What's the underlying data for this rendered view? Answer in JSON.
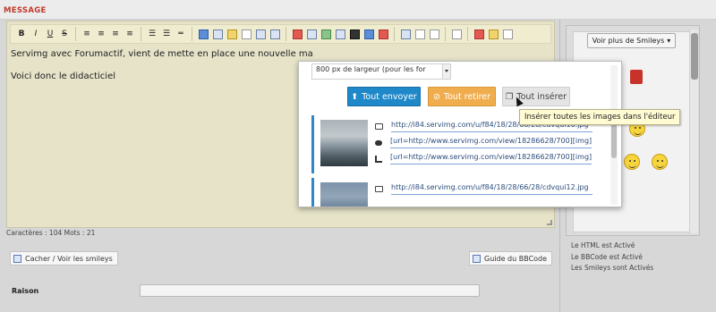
{
  "header": {
    "title": "MESSAGE"
  },
  "toolbar": {
    "bold": "B",
    "italic": "I",
    "underline": "U",
    "strike": "S"
  },
  "editor": {
    "line1": "Servimg avec Forumactif, vient de mette en place une nouvelle ma",
    "line2": "Voici donc le didacticiel"
  },
  "counter": "Caractères : 104 Mots : 21",
  "buttons": {
    "smileys": "Cacher / Voir les smileys",
    "bbcode": "Guide du BBCode"
  },
  "raison": {
    "label": "Raison",
    "value": ""
  },
  "sidebar": {
    "more_smileys": "Voir plus de Smileys",
    "status": [
      "Le HTML est Activé",
      "Le BBCode est Activé",
      "Les Smileys sont Activés"
    ]
  },
  "popup": {
    "select_value": "800 px de largeur (pour les for",
    "send_label": "Tout envoyer",
    "remove_label": "Tout retirer",
    "insert_label": "Tout insérer",
    "entries": [
      {
        "url": "http://i84.servimg.com/u/f84/18/28/66/28/cdvqui10.jpg",
        "bbcode": "[url=http://www.servimg.com/view/18286628/700][img]http:/",
        "crop": "[url=http://www.servimg.com/view/18286628/700][img]http:/"
      },
      {
        "url": "http://i84.servimg.com/u/f84/18/28/66/28/cdvqui12.jpg"
      }
    ]
  },
  "tooltip": "Insérer toutes les images dans l'éditeur",
  "colors": {
    "accent_blue": "#1e88c8",
    "accent_orange": "#f0ad4e",
    "title_red": "#c0392b",
    "editor_bg": "#e6e3c8",
    "tooltip_bg": "#fffbd2"
  }
}
